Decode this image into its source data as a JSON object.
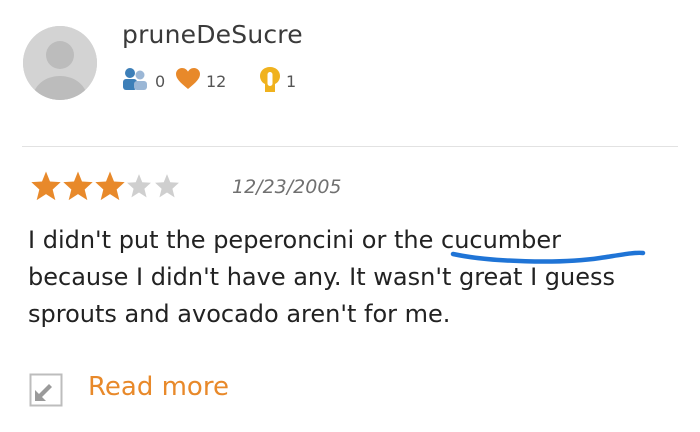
{
  "user": {
    "name": "pruneDeSucre",
    "stats": {
      "followers": "0",
      "favorites": "12",
      "reviews": "1"
    }
  },
  "review": {
    "rating": 3,
    "max_rating": 5,
    "date": "12/23/2005",
    "text": "I didn't put the peperoncini or the cucumber\nbecause I didn't have any. It wasn't great I guess\nsprouts and avocado aren't for me."
  },
  "read_more": {
    "label": "Read more"
  },
  "colors": {
    "accent_orange": "#e8892a",
    "star_empty": "#cfcfcf",
    "follower_icon": "#3d7fb8",
    "markup_blue": "#1f74d6"
  }
}
